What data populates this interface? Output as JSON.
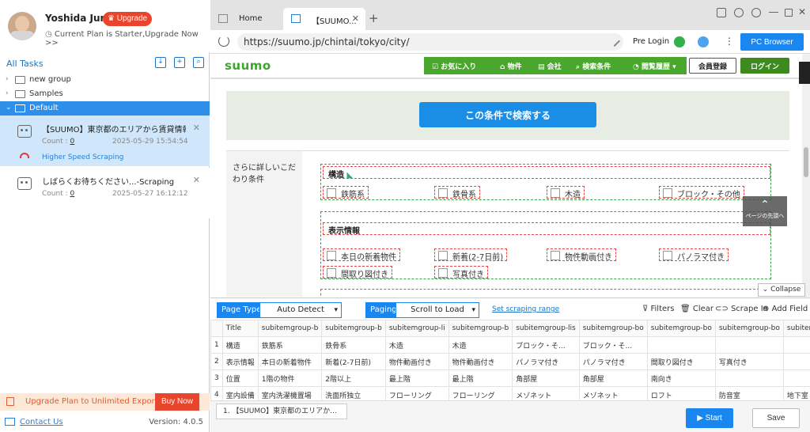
{
  "user": {
    "name": "Yoshida Jun",
    "upgrade_label": "Upgrade",
    "plan_text": "Current Plan is Starter,Upgrade Now >>"
  },
  "tasks_panel": {
    "title": "All Tasks",
    "tree": [
      {
        "label": "new group"
      },
      {
        "label": "Samples"
      },
      {
        "label": "Default"
      }
    ],
    "tasks": [
      {
        "name": "【SUUMO】東京都のエリアから賃貸情報...",
        "count_label": "Count :",
        "count": "0",
        "time": "2025-05-29 15:54:54",
        "mode": "Higher Speed Scraping"
      },
      {
        "name": "しばらくお待ちください...-Scraping",
        "count_label": "Count :",
        "count": "0",
        "time": "2025-05-27 16:12:12"
      }
    ],
    "upgrade_bar": {
      "text": "Upgrade Plan to Unlimited Export",
      "buy_label": "Buy Now"
    },
    "contact_label": "Contact Us",
    "version": "Version: 4.0.5"
  },
  "browser": {
    "tabs": [
      {
        "label": "Home"
      },
      {
        "label": "【SUUMO..."
      }
    ],
    "url": "https://suumo.jp/chintai/tokyo/city/",
    "pre_login": "Pre Login",
    "pc_browser": "PC Browser"
  },
  "suumo": {
    "logo": "suumo",
    "nav": [
      "お気に入り",
      "物件",
      "会社",
      "検索条件",
      "閲覧履歴"
    ],
    "register": "会員登録",
    "login": "ログイン",
    "search_button": "この条件で検索する",
    "side_label": "さらに詳しいこだわり条件",
    "group1": {
      "title": "構造",
      "options": [
        "鉄筋系",
        "鉄骨系",
        "木造",
        "ブロック・その他"
      ]
    },
    "group2": {
      "title": "表示情報",
      "options": [
        "本日の新着物件",
        "新着(2-7日前)",
        "物件動画付き",
        "パノラマ付き",
        "間取り図付き",
        "写真付き"
      ]
    },
    "page_top": "ページの先頭へ"
  },
  "panel": {
    "collapse": "Collapse",
    "page_type_label": "Page Type",
    "page_type_value": "Auto Detect",
    "paging_label": "Paging",
    "paging_value": "Scroll to Load",
    "set_range": "Set scraping range",
    "filters": "Filters",
    "clear": "Clear",
    "scrape_in": "Scrape In",
    "add_field": "Add Field"
  },
  "table": {
    "headers": [
      "",
      "Title",
      "subitemgroup-b",
      "subitemgroup-b",
      "subitemgroup-li",
      "subitemgroup-b",
      "subitemgroup-lis",
      "subitemgroup-bo",
      "subitemgroup-bo",
      "subitemgroup-bo",
      "subitemgroup-"
    ],
    "rows": [
      [
        "1",
        "構造",
        "鉄筋系",
        "鉄骨系",
        "木造",
        "木造",
        "ブロック・そ...",
        "ブロック・そ...",
        "",
        "",
        ""
      ],
      [
        "2",
        "表示情報",
        "本日の新着物件",
        "新着(2-7日前)",
        "物件動画付き",
        "物件動画付き",
        "パノラマ付き",
        "パノラマ付き",
        "間取り図付き",
        "写真付き",
        ""
      ],
      [
        "3",
        "位置",
        "1階の物件",
        "2階以上",
        "最上階",
        "最上階",
        "角部屋",
        "角部屋",
        "南向き",
        "",
        ""
      ],
      [
        "4",
        "室内設備",
        "室内洗濯機置場",
        "洗面所独立",
        "フローリング",
        "フローリング",
        "メゾネット",
        "メゾネット",
        "ロフト",
        "防音室",
        "地下室"
      ]
    ]
  },
  "bottom": {
    "task_pill": "1. 【SUUMO】東京都のエリアか...",
    "start": "Start",
    "save": "Save"
  },
  "colors": {
    "accent": "#1a86f0",
    "suumo_green": "#4aa72d",
    "upgrade_red": "#e8452c"
  }
}
